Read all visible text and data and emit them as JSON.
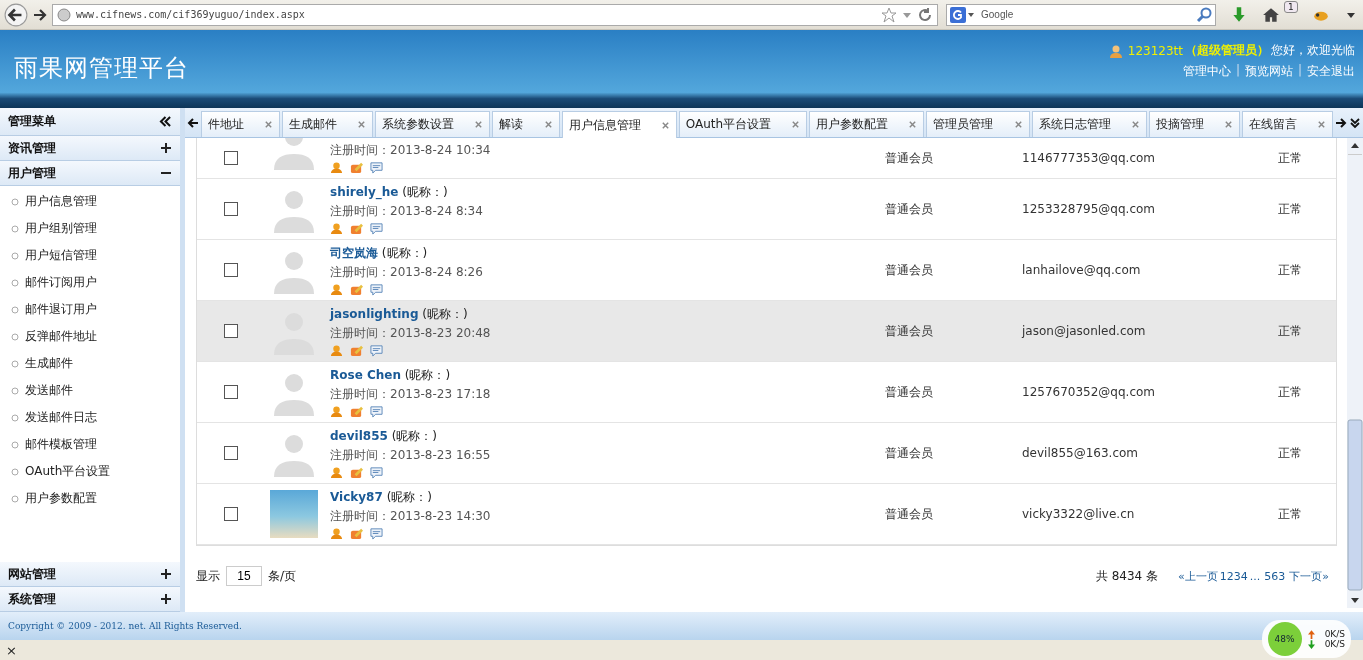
{
  "browser": {
    "url": "www.cifnews.com/cif369yuguo/index.aspx",
    "search_placeholder": "Google",
    "badge": "1"
  },
  "header": {
    "title": "雨果网管理平台",
    "user": "123123tt",
    "role": "（超级管理员）",
    "greeting": "您好，欢迎光临",
    "links": [
      "管理中心",
      "预览网站",
      "安全退出"
    ],
    "separator": "|"
  },
  "sidebar": {
    "title": "管理菜单",
    "sections": [
      {
        "label": "资讯管理",
        "expanded": false
      },
      {
        "label": "用户管理",
        "expanded": true,
        "children": [
          "用户信息管理",
          "用户组别管理",
          "用户短信管理",
          "邮件订阅用户",
          "邮件退订用户",
          "反弹邮件地址",
          "生成邮件",
          "发送邮件",
          "发送邮件日志",
          "邮件模板管理",
          "OAuth平台设置",
          "用户参数配置"
        ]
      },
      {
        "label": "网站管理",
        "expanded": false
      },
      {
        "label": "系统管理",
        "expanded": false
      }
    ]
  },
  "tabs": [
    {
      "label": "件地址",
      "selected": false
    },
    {
      "label": "生成邮件",
      "selected": false
    },
    {
      "label": "系统参数设置",
      "selected": false
    },
    {
      "label": "解读",
      "selected": false
    },
    {
      "label": "用户信息管理",
      "selected": true
    },
    {
      "label": "OAuth平台设置",
      "selected": false
    },
    {
      "label": "用户参数配置",
      "selected": false
    },
    {
      "label": "管理员管理",
      "selected": false
    },
    {
      "label": "系统日志管理",
      "selected": false
    },
    {
      "label": "投摘管理",
      "selected": false
    },
    {
      "label": "在线留言",
      "selected": false
    }
  ],
  "rows": [
    {
      "time": "注册时间：2013-8-24 10:34",
      "role": "普通会员",
      "email": "1146777353@qq.com",
      "status": "正常",
      "checked": false,
      "highlighted": false,
      "has_photo": false
    },
    {
      "name": "shirely_he",
      "nick": "(昵称：)",
      "time": "注册时间：2013-8-24 8:34",
      "role": "普通会员",
      "email": "1253328795@qq.com",
      "status": "正常",
      "checked": false,
      "highlighted": false,
      "has_photo": false
    },
    {
      "name": "司空岚海",
      "nick": "(昵称：)",
      "time": "注册时间：2013-8-24 8:26",
      "role": "普通会员",
      "email": "lanhailove@qq.com",
      "status": "正常",
      "checked": false,
      "highlighted": false,
      "has_photo": false
    },
    {
      "name": "jasonlighting",
      "nick": "(昵称：)",
      "time": "注册时间：2013-8-23 20:48",
      "role": "普通会员",
      "email": "jason@jasonled.com",
      "status": "正常",
      "checked": false,
      "highlighted": true,
      "has_photo": false
    },
    {
      "name": "Rose Chen",
      "nick": "(昵称：)",
      "time": "注册时间：2013-8-23 17:18",
      "role": "普通会员",
      "email": "1257670352@qq.com",
      "status": "正常",
      "checked": false,
      "highlighted": false,
      "has_photo": false
    },
    {
      "name": "devil855",
      "nick": "(昵称：)",
      "time": "注册时间：2013-8-23 16:55",
      "role": "普通会员",
      "email": "devil855@163.com",
      "status": "正常",
      "checked": false,
      "highlighted": false,
      "has_photo": false
    },
    {
      "name": "Vicky87",
      "nick": "(昵称：)",
      "time": "注册时间：2013-8-23 14:30",
      "role": "普通会员",
      "email": "vicky3322@live.cn",
      "status": "正常",
      "checked": false,
      "highlighted": false,
      "has_photo": true
    }
  ],
  "pager": {
    "show": "显示",
    "page_size": "15",
    "per_page": "条/页",
    "total": "共 8434 条",
    "prev": "«上一页",
    "pages": [
      "1",
      "2",
      "3",
      "4"
    ],
    "ellipsis": "...",
    "last": "563",
    "next": "下一页»"
  },
  "footer": {
    "copyright": "Copyright © 2009 - 2012. net. All Rights Reserved."
  },
  "status_bar": {
    "close": "×",
    "meter": "48%",
    "up": "0K/S",
    "down": "0K/S"
  }
}
